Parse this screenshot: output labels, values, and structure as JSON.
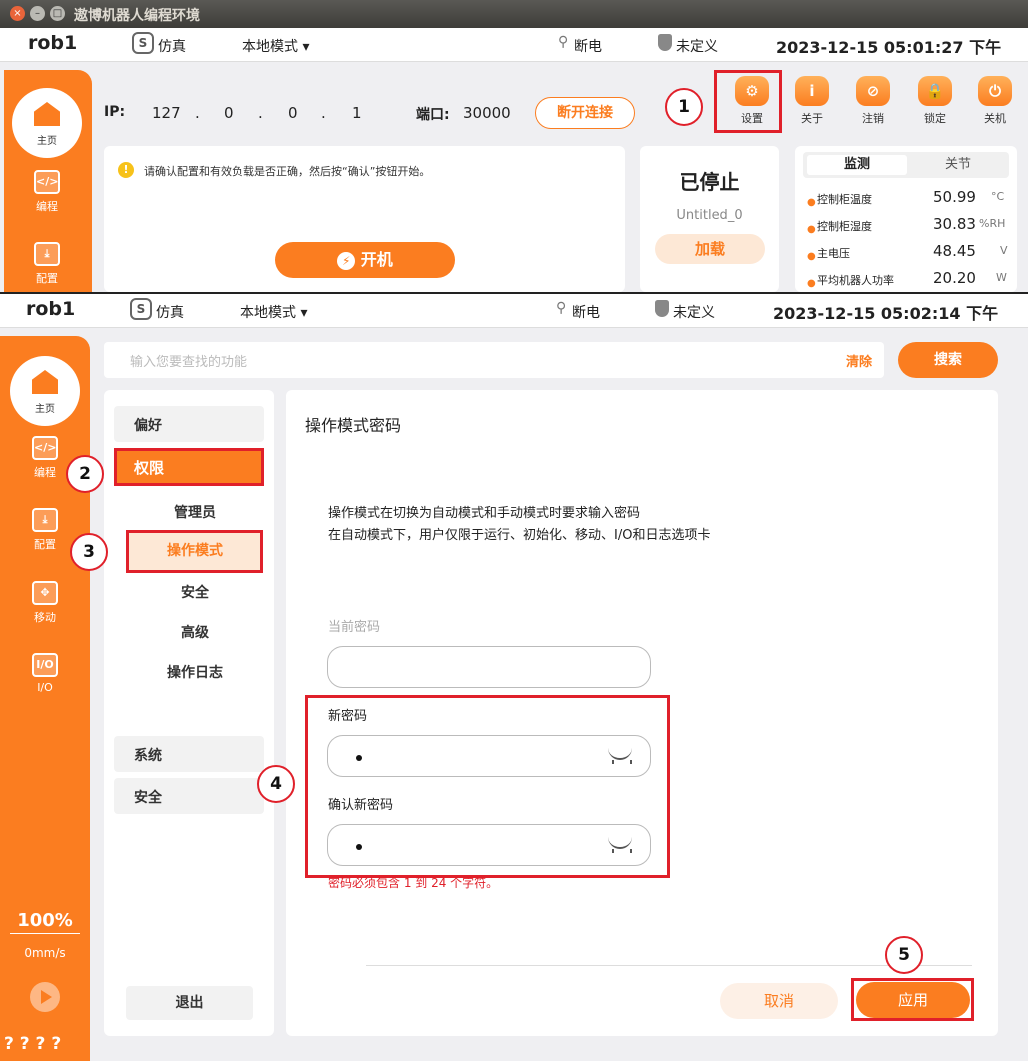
{
  "window": {
    "title": "遨博机器人编程环境"
  },
  "top": {
    "robot": "rob1",
    "sim": "仿真",
    "mode": "本地模式",
    "power": "断电",
    "safety": "未定义",
    "datetime": "2023-12-15 05:01:27 下午",
    "ip_label": "IP:",
    "ip": [
      "127",
      ".",
      "0",
      ".",
      "0",
      ".",
      "1"
    ],
    "port_label": "端口:",
    "port": "30000",
    "disconnect": "断开连接",
    "tools": [
      {
        "label": "设置",
        "icon": "gear-icon"
      },
      {
        "label": "关于",
        "icon": "info-icon"
      },
      {
        "label": "注销",
        "icon": "logout-icon"
      },
      {
        "label": "锁定",
        "icon": "lock-icon"
      },
      {
        "label": "关机",
        "icon": "power-icon"
      }
    ],
    "notice": "请确认配置和有效负载是否正确，然后按“确认”按钮开始。",
    "power_on": "开机",
    "state": "已停止",
    "program": "Untitled_0",
    "load": "加载",
    "tabs": [
      "监测",
      "关节"
    ],
    "metrics": [
      {
        "name": "控制柜温度",
        "value": "50.99",
        "unit": "°C"
      },
      {
        "name": "控制柜湿度",
        "value": "30.83",
        "unit": "%RH"
      },
      {
        "name": "主电压",
        "value": "48.45",
        "unit": "V"
      },
      {
        "name": "平均机器人功率",
        "value": "20.20",
        "unit": "W"
      }
    ],
    "nav": [
      {
        "label": "主页"
      },
      {
        "label": "编程"
      },
      {
        "label": "配置"
      }
    ]
  },
  "bottom": {
    "robot": "rob1",
    "sim": "仿真",
    "mode": "本地模式",
    "power": "断电",
    "safety": "未定义",
    "datetime": "2023-12-15 05:02:14 下午",
    "search_placeholder": "输入您要查找的功能",
    "clear": "清除",
    "search": "搜索",
    "nav": [
      {
        "label": "主页"
      },
      {
        "label": "编程",
        "icon": "</>"
      },
      {
        "label": "配置",
        "icon": "⤓"
      },
      {
        "label": "移动",
        "icon": "✥"
      },
      {
        "label": "I/O",
        "icon": "I/O"
      }
    ],
    "speed_pct": "100%",
    "speed": "0mm/s",
    "help": "? ? ? ?",
    "menu": {
      "preferences": "偏好",
      "permissions": "权限",
      "admin": "管理员",
      "op_mode": "操作模式",
      "security": "安全",
      "advanced": "高级",
      "op_log": "操作日志",
      "system": "系统",
      "safety": "安全",
      "logout": "退出"
    },
    "content": {
      "title": "操作模式密码",
      "desc1": "操作模式在切换为自动模式和手动模式时要求输入密码",
      "desc2": "在自动模式下，用户仅限于运行、初始化、移动、I/O和日志选项卡",
      "current_label": "当前密码",
      "new_label": "新密码",
      "confirm_label": "确认新密码",
      "hint": "密码必须包含 1 到 24 个字符。",
      "cancel": "取消",
      "apply": "应用"
    }
  },
  "annotations": [
    "1",
    "2",
    "3",
    "4",
    "5"
  ]
}
